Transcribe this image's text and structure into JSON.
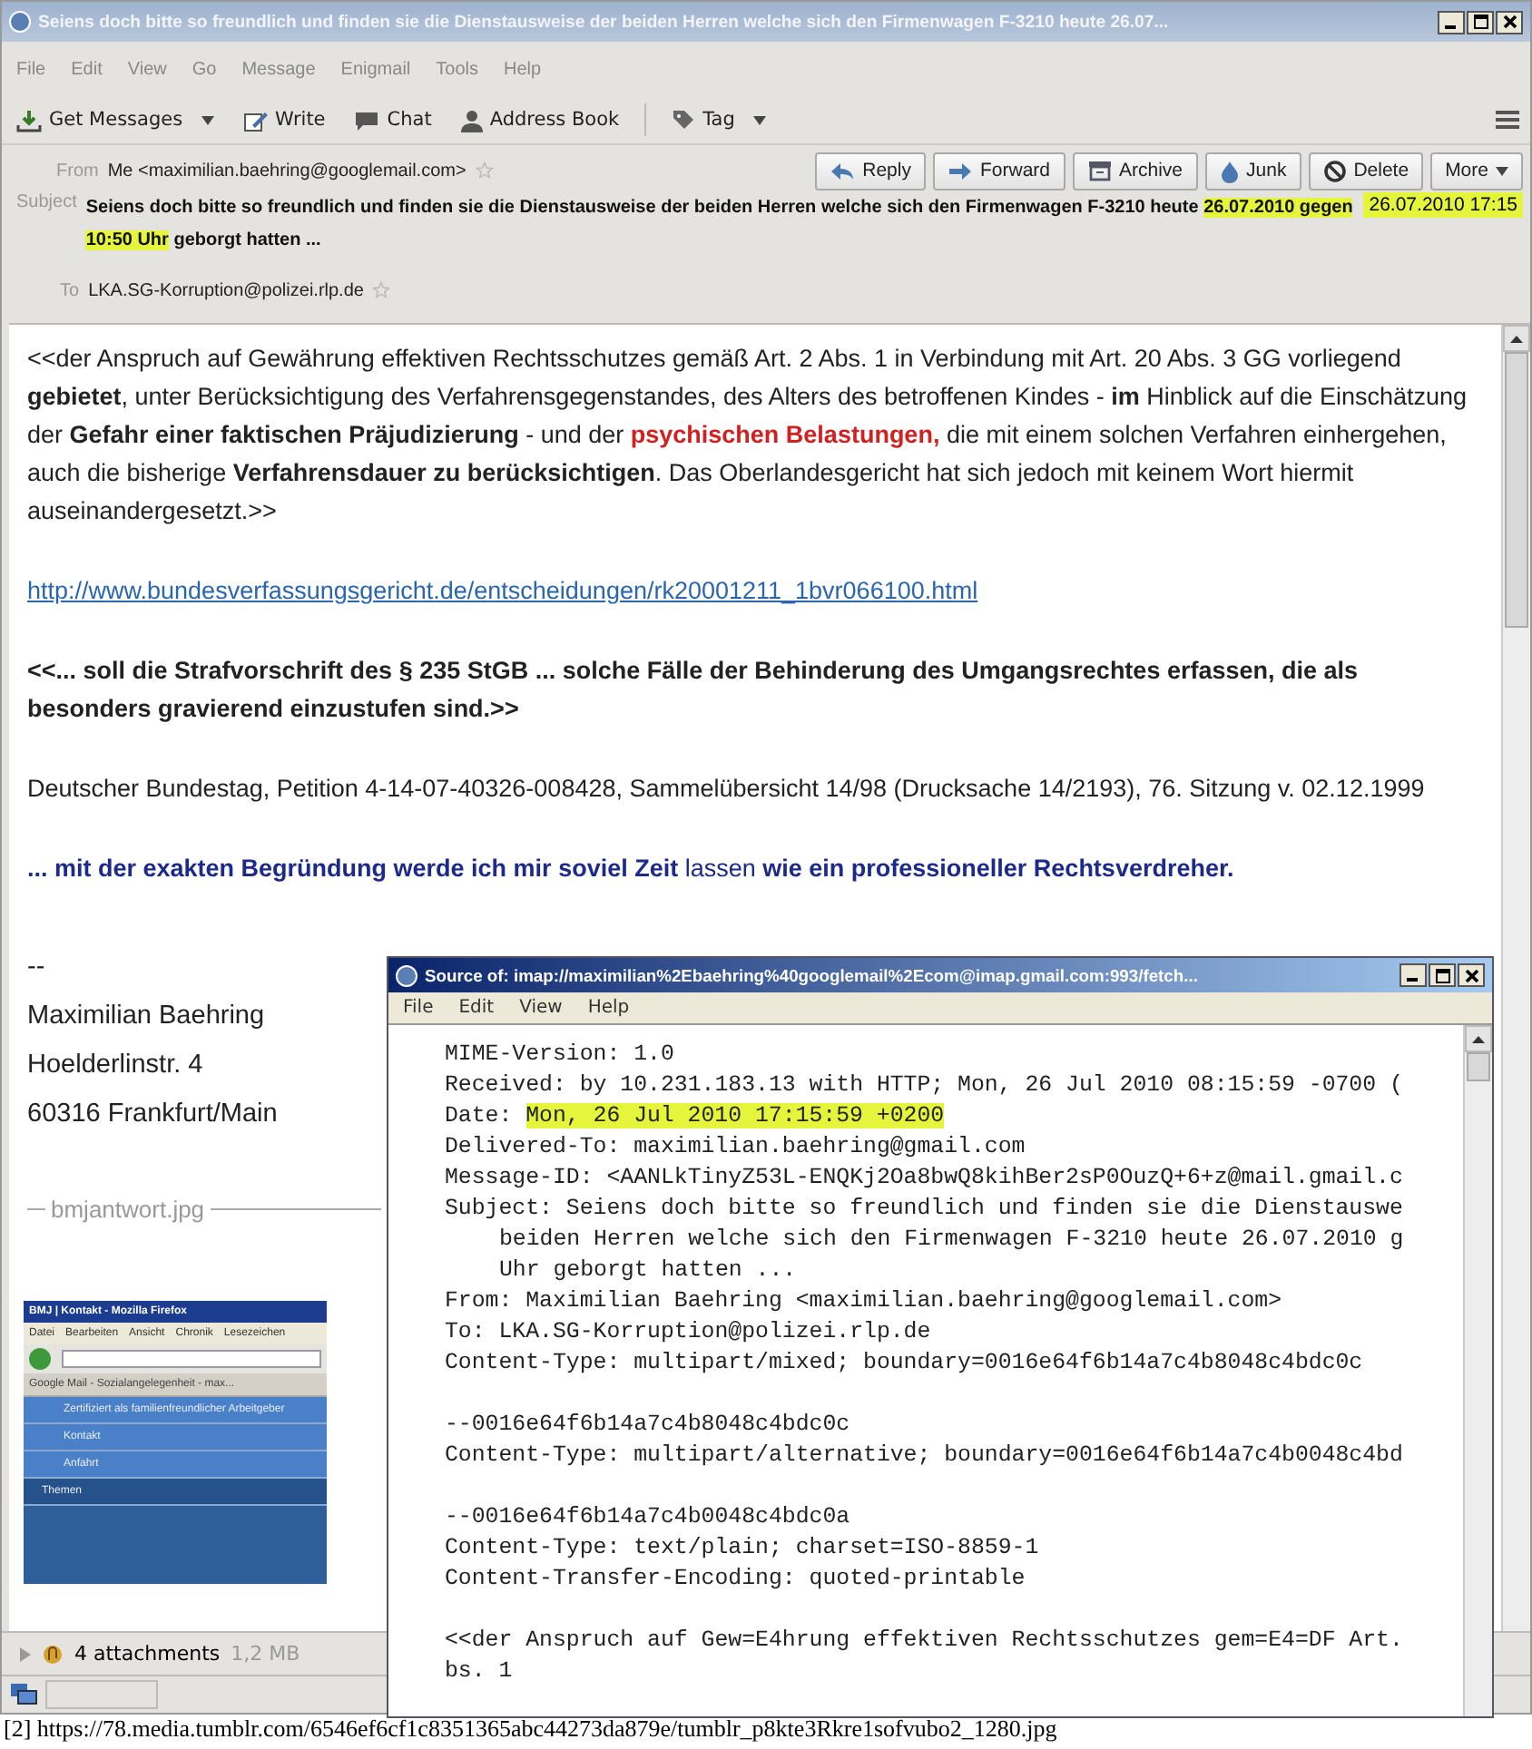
{
  "window": {
    "title": "Seiens doch bitte so freundlich und finden sie die Dienstausweise der beiden Herren welche sich den Firmenwagen F-3210 heute 26.07..."
  },
  "menu": [
    "File",
    "Edit",
    "View",
    "Go",
    "Message",
    "Enigmail",
    "Tools",
    "Help"
  ],
  "toolbar": [
    {
      "label": "Get Messages",
      "kind": "get",
      "dropdown": true
    },
    {
      "label": "Write",
      "kind": "write",
      "dropdown": false
    },
    {
      "label": "Chat",
      "kind": "chat",
      "dropdown": false
    },
    {
      "label": "Address Book",
      "kind": "contacts",
      "dropdown": false
    },
    {
      "label": "Tag",
      "kind": "tag",
      "dropdown": true
    }
  ],
  "header": {
    "from_label": "From",
    "from": "Me <maximilian.baehring@googlemail.com>",
    "actions": [
      {
        "label": "Reply",
        "kind": "reply"
      },
      {
        "label": "Forward",
        "kind": "forward"
      },
      {
        "label": "Archive",
        "kind": "archive"
      },
      {
        "label": "Junk",
        "kind": "junk"
      },
      {
        "label": "Delete",
        "kind": "delete"
      },
      {
        "label": "More",
        "kind": "more"
      }
    ],
    "subject_label": "Subject",
    "subject": [
      {
        "text": "Seiens doch bitte so freundlich und finden sie die Dienstausweise der beiden Herren welche sich den Firmenwagen F-3210 heute",
        "highlighted": false
      },
      {
        "text": "26.07.2010 gegen 10:50 Uhr",
        "highlighted": true
      },
      {
        "text": "geborgt hatten ...",
        "highlighted": false
      }
    ],
    "date": "26.07.2010 17:15",
    "date_highlighted": true,
    "to_label": "To",
    "to": "LKA.SG-Korruption@polizei.rlp.de"
  },
  "body": {
    "paragraphs": [
      {
        "kind": "text",
        "runs": [
          {
            "text": "<<der Anspruch auf Gewährung effektiven Rechtsschutzes gemäß Art. 2 Abs. 1 in Verbindung mit Art. 20 Abs. 3 GG vorliegend **gebietet**, unter Berücksichtigung des Verfahrensgegenstandes, des Alters des betroffenen Kindes - **im** Hinblick auf die Einschätzung der **Gefahr einer faktischen Präjudizierung** - und der ",
            "warning": false
          },
          {
            "text": "psychischen Belastungen,",
            "warning": true
          },
          {
            "text": " die mit einem solchen Verfahren einhergehen, auch die bisherige **Verfahrensdauer zu berücksichtigen**. Das Oberlandesgericht hat sich jedoch mit keinem Wort hiermit auseinandergesetzt.>>",
            "warning": false
          }
        ]
      },
      {
        "kind": "link",
        "runs": [
          {
            "text": "http://www.bundesverfassungsgericht.de/entscheidungen/rk20001211_1bvr066100.html",
            "warning": false
          }
        ]
      },
      {
        "kind": "quote",
        "runs": [
          {
            "text": "<<... soll die Strafvorschrift des § 235 StGB ... solche Fälle der Behinderung des Umgangsrechtes erfassen, die als besonders gravierend einzustufen sind.>>",
            "warning": false
          }
        ]
      },
      {
        "kind": "text",
        "runs": [
          {
            "text": "Deutscher Bundestag, Petition 4-14-07-40326-008428, Sammelübersicht 14/98 (Drucksache 14/2193), 76. Sitzung v. 02.12.1999",
            "warning": false
          }
        ]
      },
      {
        "kind": "closing",
        "runs": [
          {
            "text": "**... mit der exakten Begründung werde ich mir soviel Zeit** lassen **wie ein professioneller Rechtsverdreher.**",
            "warning": false
          }
        ]
      }
    ],
    "signature": [
      "--",
      "Maximilian Baehring",
      "Hoelderlinstr. 4",
      "60316 Frankfurt/Main"
    ],
    "attachment_name": "bmjantwort.jpg",
    "preview": {
      "title": "BMJ | Kontakt - Mozilla Firefox",
      "menu": [
        "Datei",
        "Bearbeiten",
        "Ansicht",
        "Chronik",
        "Lesezeichen"
      ],
      "tab": "Google Mail - Sozialangelegenheit - max...",
      "nav": [
        {
          "label": "Zertifiziert als familienfreundlicher Arbeitgeber",
          "kind": "sub"
        },
        {
          "label": "Kontakt",
          "kind": "sub"
        },
        {
          "label": "Anfahrt",
          "kind": "sub"
        },
        {
          "label": "Themen",
          "kind": "section"
        }
      ]
    }
  },
  "attachments": {
    "count": "4 attachments",
    "size": "1,2 MB"
  },
  "source_window": {
    "title": "Source of: imap://maximilian%2Ebaehring%40googlemail%2Ecom@imap.gmail.com:993/fetch...",
    "menu": [
      "File",
      "Edit",
      "View",
      "Help"
    ],
    "blocks": [
      [
        {
          "kind": "field",
          "text": "MIME-Version: 1.0"
        },
        {
          "kind": "field",
          "text": "Received: by 10.231.183.13 with HTTP; Mon, 26 Jul 2010 08:15:59 -0700 ("
        },
        {
          "kind": "field",
          "text": "Date:",
          "highlight": "Mon, 26 Jul 2010 17:15:59 +0200"
        },
        {
          "kind": "field",
          "text": "Delivered-To: maximilian.baehring@gmail.com"
        },
        {
          "kind": "field",
          "text": "Message-ID: <AANLkTinyZ53L-ENQKj2Oa8bwQ8kihBer2sP0OuzQ+6+z@mail.gmail.c"
        },
        {
          "kind": "field",
          "text": "Subject: Seiens doch bitte so freundlich und finden sie die Dienstauswe"
        },
        {
          "kind": "continuation",
          "text": "beiden Herren welche sich den Firmenwagen F-3210 heute 26.07.2010 g"
        },
        {
          "kind": "continuation",
          "text": "Uhr geborgt hatten ..."
        },
        {
          "kind": "field",
          "text": "From: Maximilian Baehring <maximilian.baehring@googlemail.com>"
        },
        {
          "kind": "field",
          "text": "To: LKA.SG-Korruption@polizei.rlp.de"
        },
        {
          "kind": "field",
          "text": "Content-Type: multipart/mixed; boundary=0016e64f6b14a7c4b8048c4bdc0c"
        }
      ],
      [
        {
          "kind": "field",
          "text": "--0016e64f6b14a7c4b8048c4bdc0c"
        },
        {
          "kind": "field",
          "text": "Content-Type: multipart/alternative; boundary=0016e64f6b14a7c4b0048c4bd"
        }
      ],
      [
        {
          "kind": "field",
          "text": "--0016e64f6b14a7c4b0048c4bdc0a"
        },
        {
          "kind": "field",
          "text": "Content-Type: text/plain; charset=ISO-8859-1"
        },
        {
          "kind": "field",
          "text": "Content-Transfer-Encoding: quoted-printable"
        }
      ],
      [
        {
          "kind": "field",
          "text": "<<der Anspruch auf Gew=E4hrung effektiven Rechtsschutzes gem=E4=DF Art."
        },
        {
          "kind": "field",
          "text": "bs. 1"
        }
      ]
    ]
  },
  "caption": "[2] https://78.media.tumblr.com/6546ef6cf1c8351365abc44273da879e/tumblr_p8kte3Rkre1sofvubo2_1280.jpg"
}
